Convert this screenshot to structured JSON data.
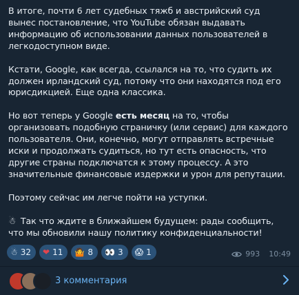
{
  "message": {
    "p1": "В итоге, почти 6 лет судебных тяжб и австрийский суд вынес постановление, что YouTube обязан выдавать информацию об использовании данных пользователей в легкодоступном виде.",
    "p2": "Кстати, Google, как всегда, ссылался на то, что судить их должен ирландский суд, потому что они находятся под его юрисдикцией.  Еще одна классика.",
    "p3_before": "Но вот теперь у Google ",
    "p3_bold": "есть месяц",
    "p3_after": " на то, чтобы организовать подобную страничку (или сервис) для каждого пользователя. Они, конечно, могут отправлять встречные иски и продолжать судиться, но тут есть опасность, что другие страны подключатся к этому процессу. А это значительные финансовые издержки и урон для репутации.",
    "p4": "Поэтому сейчас им легче пойти на уступки.",
    "p5_emoji": "☃",
    "p5": "Так что ждите в ближайшем будущем: рады сообщить, что мы обновили нашу политику конфиденциальности!"
  },
  "reactions": [
    {
      "emoji": "☃",
      "count": "32"
    },
    {
      "emoji": "❤",
      "count": "11"
    },
    {
      "emoji": "🤷",
      "count": "8"
    },
    {
      "emoji": "👀",
      "count": "3"
    },
    {
      "emoji": "😱",
      "count": "1"
    }
  ],
  "meta": {
    "views": "993",
    "time": "10:49",
    "eye_icon": "eye-icon"
  },
  "comments": {
    "label": "3 комментария",
    "icon": "chevron-right-icon"
  },
  "colors": {
    "bubble": "#182533",
    "reaction_bg": "#2b5278",
    "link": "#6ab3f3",
    "meta": "#7c8ea0"
  }
}
